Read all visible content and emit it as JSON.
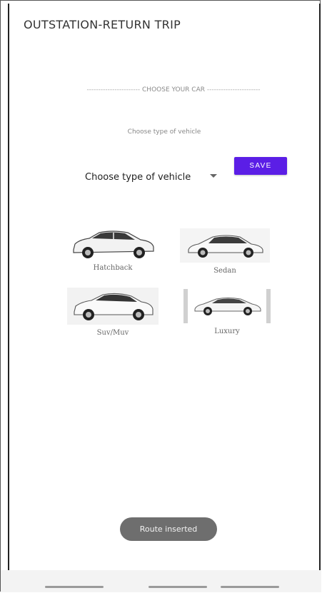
{
  "appbar": {
    "title": "OUTSTATION-RETURN TRIP"
  },
  "section": {
    "header_label": "CHOOSE YOUR CAR",
    "dashes": "-----------------------"
  },
  "vehicle": {
    "hint": "Choose type of vehicle",
    "select_value": "Choose type of vehicle"
  },
  "save_label": "SAVE",
  "cars": [
    {
      "label": "Hatchback",
      "icon": "hatchback-car-icon"
    },
    {
      "label": "Sedan",
      "icon": "sedan-car-icon"
    },
    {
      "label": "Suv/Muv",
      "icon": "suv-car-icon"
    },
    {
      "label": "Luxury",
      "icon": "luxury-car-icon"
    }
  ],
  "toast": "Route inserted",
  "colors": {
    "save_button": "#5b1ee6",
    "toast_bg": "#6e6e6e"
  }
}
